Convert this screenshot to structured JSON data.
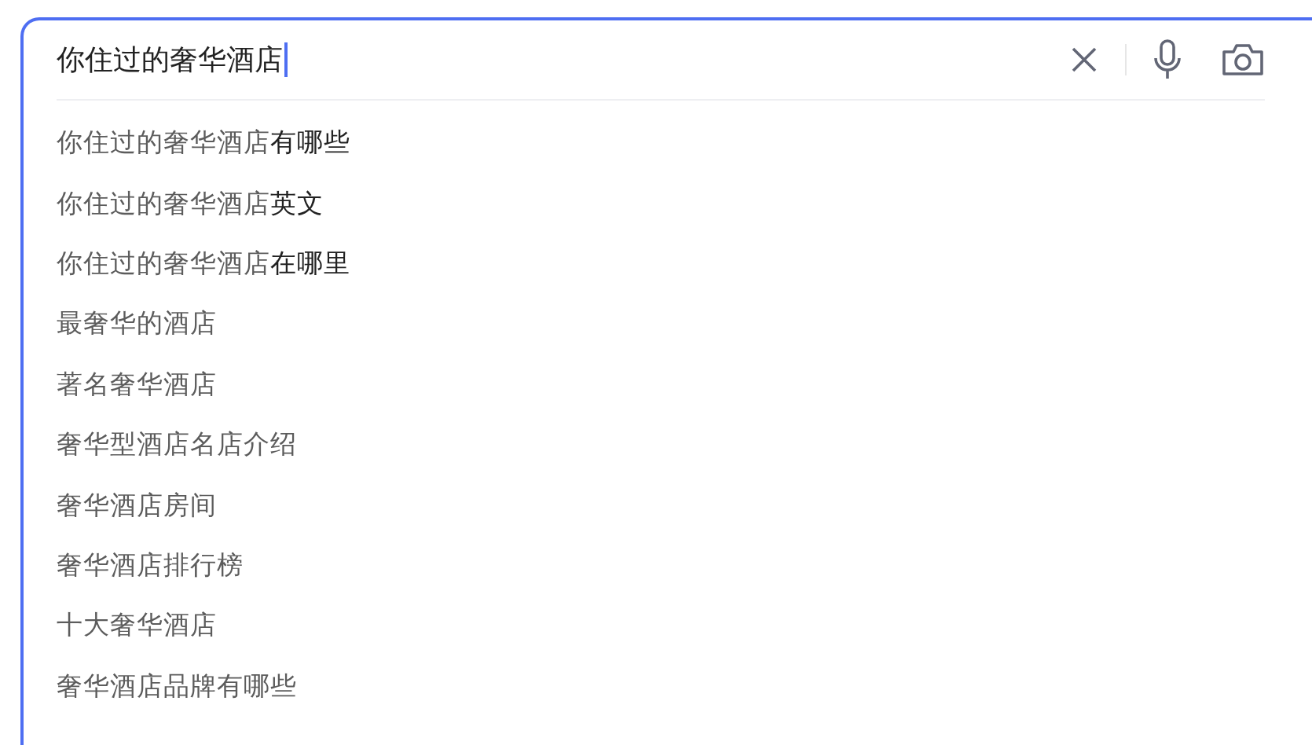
{
  "search": {
    "value": "你住过的奢华酒店"
  },
  "suggestions": [
    {
      "text": "你住过的奢华酒店",
      "extra": "有哪些"
    },
    {
      "text": "你住过的奢华酒店",
      "extra": "英文"
    },
    {
      "text": "你住过的奢华酒店",
      "extra": "在哪里"
    },
    {
      "text": "最奢华的酒店"
    },
    {
      "text": "著名奢华酒店"
    },
    {
      "text": "奢华型酒店名店介绍"
    },
    {
      "text": "奢华酒店房间"
    },
    {
      "text": "奢华酒店排行榜"
    },
    {
      "text": "十大奢华酒店"
    },
    {
      "text": "奢华酒店品牌有哪些"
    }
  ]
}
